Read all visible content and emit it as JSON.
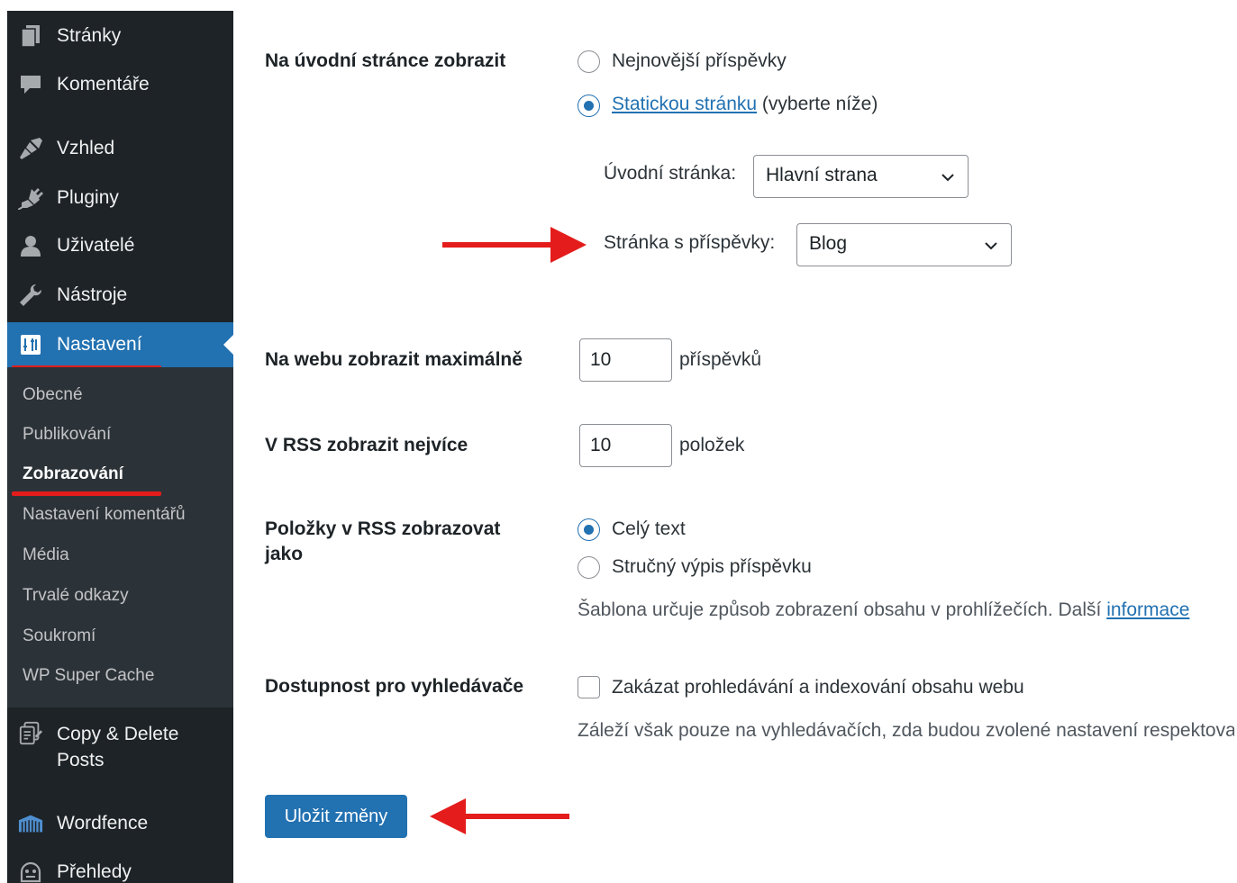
{
  "sidebar": {
    "items": [
      {
        "label": "Stránky",
        "icon": "pages-icon"
      },
      {
        "label": "Komentáře",
        "icon": "comments-icon"
      },
      {
        "label": "Vzhled",
        "icon": "appearance-icon"
      },
      {
        "label": "Pluginy",
        "icon": "plugins-icon"
      },
      {
        "label": "Uživatelé",
        "icon": "users-icon"
      },
      {
        "label": "Nástroje",
        "icon": "tools-icon"
      },
      {
        "label": "Nastavení",
        "icon": "settings-icon",
        "active": true
      },
      {
        "label": "Copy & Delete Posts",
        "icon": "copy-delete-icon"
      },
      {
        "label": "Wordfence",
        "icon": "wordfence-icon"
      },
      {
        "label": "Přehledy",
        "icon": "insights-icon"
      }
    ],
    "submenu": [
      {
        "label": "Obecné"
      },
      {
        "label": "Publikování"
      },
      {
        "label": "Zobrazování",
        "current": true
      },
      {
        "label": "Nastavení komentářů"
      },
      {
        "label": "Média"
      },
      {
        "label": "Trvalé odkazy"
      },
      {
        "label": "Soukromí"
      },
      {
        "label": "WP Super Cache"
      }
    ]
  },
  "settings": {
    "front_page": {
      "label": "Na úvodní stránce zobrazit",
      "option_latest": "Nejnovější příspěvky",
      "option_static_link": "Statickou stránku",
      "option_static_suffix": " (vyberte níže)",
      "selected": "static",
      "homepage_label": "Úvodní stránka:",
      "homepage_value": "Hlavní strana",
      "posts_page_label": "Stránka s příspěvky:",
      "posts_page_value": "Blog"
    },
    "posts_per_page": {
      "label": "Na webu zobrazit maximálně",
      "value": "10",
      "unit": "příspěvků"
    },
    "rss_items": {
      "label": "V RSS zobrazit nejvíce",
      "value": "10",
      "unit": "položek"
    },
    "rss_display": {
      "label_line1": "Položky v RSS zobrazovat",
      "label_line2": "jako",
      "option_full": "Celý text",
      "option_excerpt": "Stručný výpis příspěvku",
      "selected": "full",
      "description": "Šablona určuje způsob zobrazení obsahu v prohlížečích. Další ",
      "description_link": "informace"
    },
    "search_visibility": {
      "label": "Dostupnost pro vyhledávače",
      "checkbox_label": "Zakázat prohledávání a indexování obsahu webu",
      "checked": false,
      "description": "Záleží však pouze na vyhledávačích, zda budou zvolené nastavení respektovat."
    },
    "save_button": "Uložit změny"
  },
  "colors": {
    "sidebar_bg": "#1d2327",
    "submenu_bg": "#2c3338",
    "accent": "#2271b1",
    "annotation_red": "#e41c1c"
  }
}
